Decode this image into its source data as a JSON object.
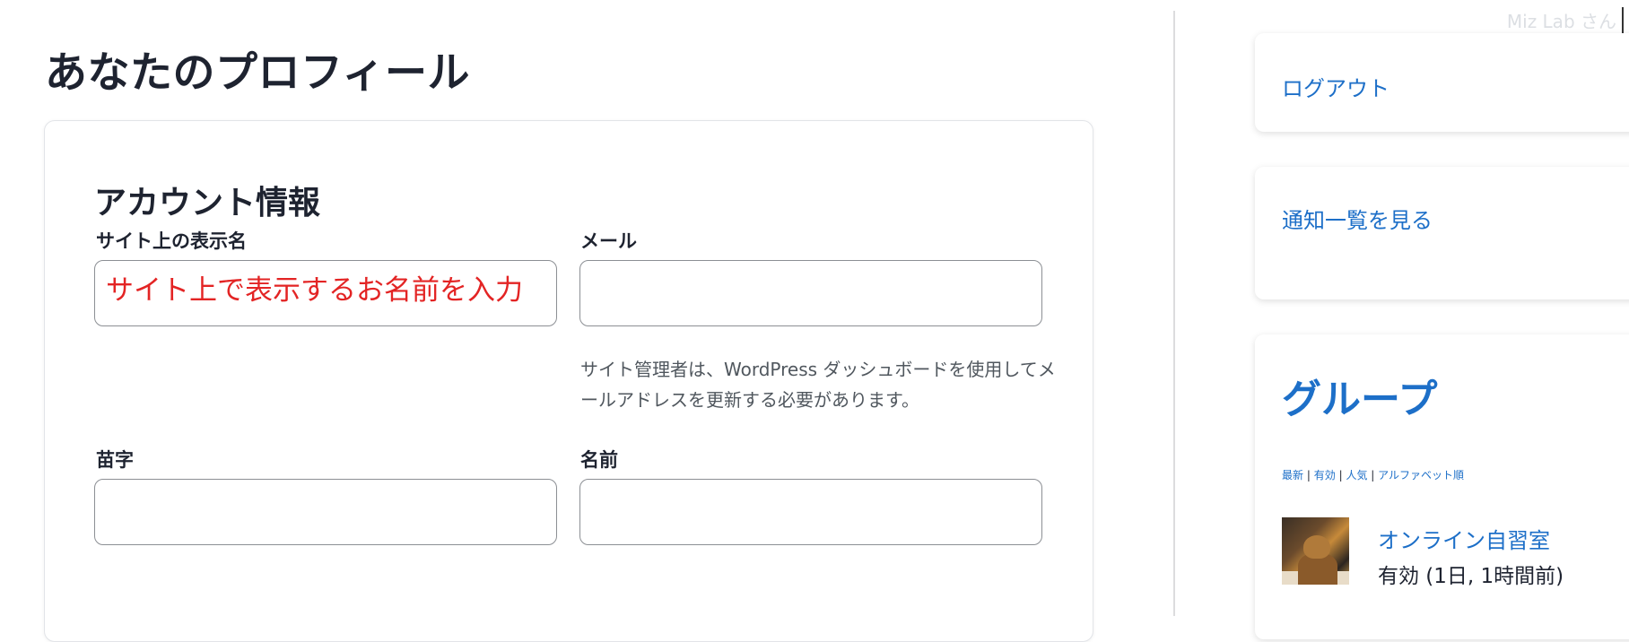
{
  "page": {
    "title": "あなたのプロフィール"
  },
  "topbar": {
    "greeting": "Miz Lab さん"
  },
  "account": {
    "section_title": "アカウント情報",
    "display_name": {
      "label": "サイト上の表示名",
      "value": "",
      "placeholder": "サイト上で表示するお名前を入力"
    },
    "email": {
      "label": "メール",
      "value": "",
      "help": "サイト管理者は、WordPress ダッシュボードを使用してメールアドレスを更新する必要があります。"
    },
    "last_name": {
      "label": "苗字",
      "value": ""
    },
    "first_name": {
      "label": "名前",
      "value": ""
    }
  },
  "sidebar": {
    "logout": "ログアウト",
    "notifications": "通知一覧を見る",
    "groups": {
      "heading": "グループ",
      "filters": [
        "最新",
        "有効",
        "人気",
        "アルファベット順"
      ],
      "filter_separator": "|",
      "items": [
        {
          "name": "オンライン自習室",
          "activity": "有効 (1日, 1時間前)",
          "avatar_icon": "cat-studying-avatar"
        }
      ]
    }
  },
  "colors": {
    "accent": "#1d6fc8",
    "placeholder_red": "#e32424",
    "text": "#1e2330",
    "muted": "#50575e"
  }
}
